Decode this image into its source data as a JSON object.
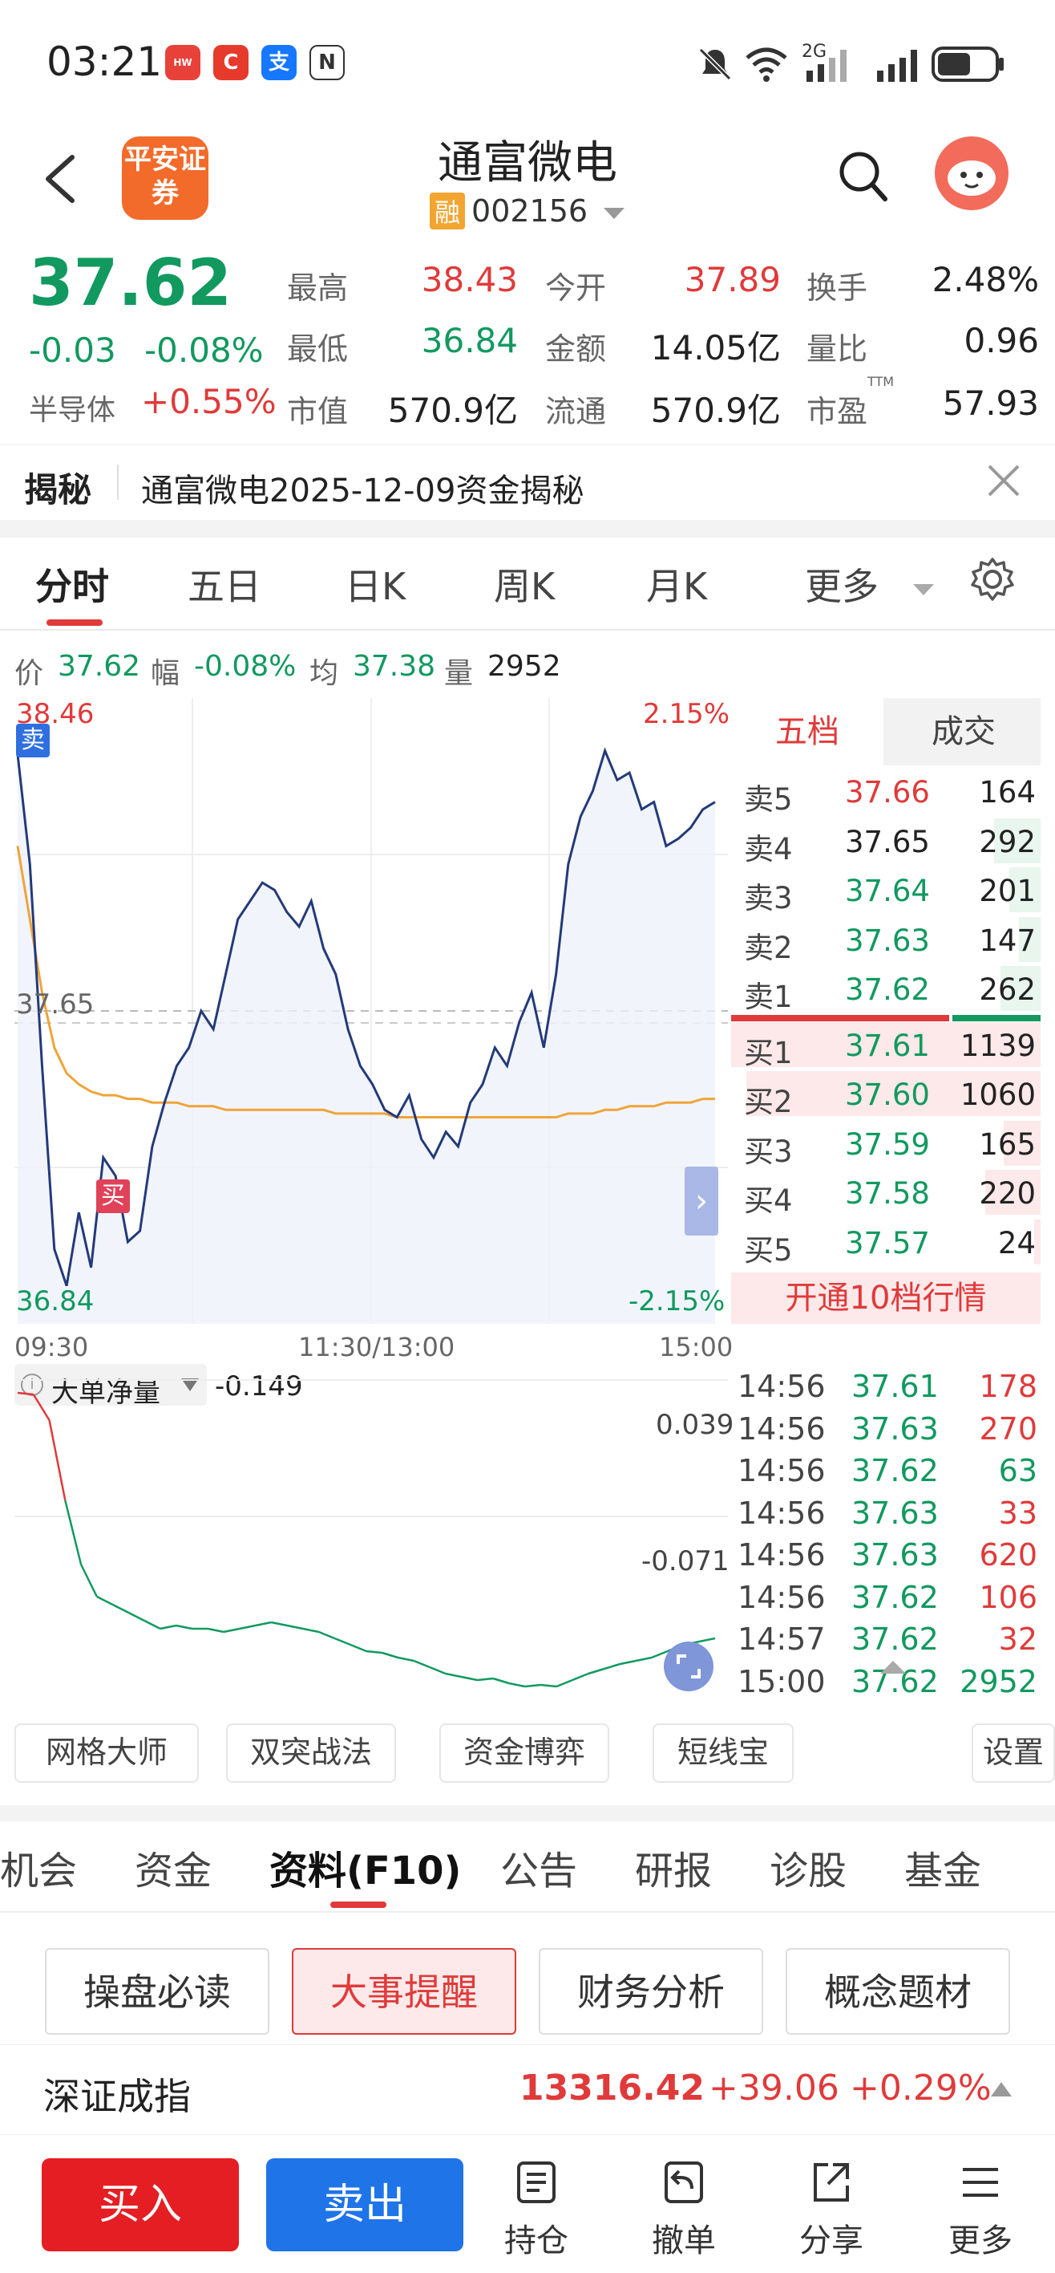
{
  "status_bar": {
    "time": "03:21",
    "network": "2G",
    "icons": [
      "huawei-app-icon",
      "c-app-icon",
      "alipay-icon",
      "nfc-icon",
      "mute-icon",
      "wifi-icon",
      "signal-icon",
      "battery-icon"
    ]
  },
  "header": {
    "logo_text": "平安证券",
    "title": "通富微电",
    "tag": "融",
    "code": "002156"
  },
  "quote": {
    "price": "37.62",
    "change": "-0.03",
    "change_pct": "-0.08%",
    "sector_name": "半导体",
    "sector_pct": "+0.55%",
    "rows": [
      [
        {
          "label": "最高",
          "value": "38.43",
          "color": "red"
        },
        {
          "label": "今开",
          "value": "37.89",
          "color": "red"
        },
        {
          "label": "换手",
          "value": "2.48%",
          "color": "black"
        }
      ],
      [
        {
          "label": "最低",
          "value": "36.84",
          "color": "green"
        },
        {
          "label": "金额",
          "value": "14.05亿",
          "color": "black"
        },
        {
          "label": "量比",
          "value": "0.96",
          "color": "black"
        }
      ],
      [
        {
          "label": "市值",
          "value": "570.9亿",
          "color": "black"
        },
        {
          "label": "流通",
          "value": "570.9亿",
          "color": "black"
        },
        {
          "label": "市盈",
          "value": "57.93",
          "color": "black",
          "sup": "TTM"
        }
      ]
    ]
  },
  "notice": {
    "tag": "揭秘",
    "text": "通富微电2025-12-09资金揭秘"
  },
  "chart_tabs": [
    "分时",
    "五日",
    "日K",
    "周K",
    "月K",
    "更多"
  ],
  "info_line": {
    "price_label": "价",
    "price": "37.62",
    "range_label": "幅",
    "range": "-0.08%",
    "avg_label": "均",
    "avg": "37.38",
    "vol_label": "量",
    "vol": "2952"
  },
  "chart_labels": {
    "max": "38.46",
    "min": "36.84",
    "max_pct": "2.15%",
    "min_pct": "-2.15%",
    "ref": "37.65",
    "sell_tag": "卖",
    "buy_tag": "买",
    "t_start": "09:30",
    "t_mid": "11:30/13:00",
    "t_end": "15:00"
  },
  "chart_data": {
    "type": "line",
    "x_range": [
      "09:30",
      "15:00"
    ],
    "ylim": [
      36.84,
      38.46
    ],
    "series": [
      {
        "name": "价",
        "values": [
          38.35,
          38.05,
          37.5,
          37.0,
          36.9,
          37.1,
          36.95,
          37.25,
          37.2,
          37.02,
          37.05,
          37.28,
          37.4,
          37.5,
          37.55,
          37.65,
          37.6,
          37.75,
          37.9,
          37.95,
          38.0,
          37.98,
          37.92,
          37.88,
          37.95,
          37.82,
          37.75,
          37.6,
          37.5,
          37.45,
          37.38,
          37.36,
          37.42,
          37.3,
          37.25,
          37.32,
          37.28,
          37.4,
          37.45,
          37.55,
          37.5,
          37.62,
          37.7,
          37.55,
          37.75,
          38.05,
          38.18,
          38.25,
          38.36,
          38.28,
          38.3,
          38.2,
          38.22,
          38.1,
          38.12,
          38.15,
          38.2,
          38.22
        ]
      },
      {
        "name": "均",
        "values": [
          38.1,
          37.9,
          37.7,
          37.55,
          37.48,
          37.45,
          37.43,
          37.42,
          37.42,
          37.41,
          37.41,
          37.4,
          37.4,
          37.4,
          37.39,
          37.39,
          37.39,
          37.38,
          37.38,
          37.38,
          37.38,
          37.38,
          37.38,
          37.38,
          37.38,
          37.38,
          37.37,
          37.37,
          37.37,
          37.37,
          37.37,
          37.36,
          37.36,
          37.36,
          37.36,
          37.36,
          37.36,
          37.36,
          37.36,
          37.36,
          37.36,
          37.36,
          37.36,
          37.36,
          37.36,
          37.37,
          37.37,
          37.37,
          37.38,
          37.38,
          37.39,
          37.39,
          37.39,
          37.4,
          37.4,
          37.4,
          37.41,
          37.41
        ]
      },
      {
        "name": "大单净量",
        "values": [
          0.037,
          0.036,
          0.02,
          -0.03,
          -0.07,
          -0.09,
          -0.095,
          -0.1,
          -0.105,
          -0.11,
          -0.108,
          -0.11,
          -0.11,
          -0.112,
          -0.11,
          -0.108,
          -0.106,
          -0.108,
          -0.11,
          -0.112,
          -0.116,
          -0.12,
          -0.124,
          -0.125,
          -0.128,
          -0.13,
          -0.134,
          -0.138,
          -0.14,
          -0.142,
          -0.141,
          -0.144,
          -0.146,
          -0.145,
          -0.146,
          -0.142,
          -0.138,
          -0.135,
          -0.132,
          -0.13,
          -0.128,
          -0.124,
          -0.12,
          -0.118,
          -0.116
        ]
      }
    ],
    "y_ticks": [
      "0.039",
      "-0.071"
    ]
  },
  "indicator": {
    "name": "大单净量",
    "value": "-0.149"
  },
  "order_book": {
    "tabs": [
      "五档",
      "成交"
    ],
    "asks": [
      {
        "label": "卖5",
        "price": "37.66",
        "vol": "164",
        "price_color": "red",
        "bar": 0.0
      },
      {
        "label": "卖4",
        "price": "37.65",
        "vol": "292",
        "price_color": "black",
        "bar": 0.15
      },
      {
        "label": "卖3",
        "price": "37.64",
        "vol": "201",
        "price_color": "green",
        "bar": 0.1
      },
      {
        "label": "卖2",
        "price": "37.63",
        "vol": "147",
        "price_color": "green",
        "bar": 0.07
      },
      {
        "label": "卖1",
        "price": "37.62",
        "vol": "262",
        "price_color": "green",
        "bar": 0.13
      }
    ],
    "bids": [
      {
        "label": "买1",
        "price": "37.61",
        "vol": "1139",
        "price_color": "green",
        "bar": 1.0
      },
      {
        "label": "买2",
        "price": "37.60",
        "vol": "1060",
        "price_color": "green",
        "bar": 0.95
      },
      {
        "label": "买3",
        "price": "37.59",
        "vol": "165",
        "price_color": "green",
        "bar": 0.12
      },
      {
        "label": "买4",
        "price": "37.58",
        "vol": "220",
        "price_color": "green",
        "bar": 0.18
      },
      {
        "label": "买5",
        "price": "37.57",
        "vol": "24",
        "price_color": "green",
        "bar": 0.02
      }
    ],
    "upgrade": "开通10档行情"
  },
  "trades": [
    {
      "time": "14:56",
      "price": "37.61",
      "vol": "178",
      "color": "red"
    },
    {
      "time": "14:56",
      "price": "37.63",
      "vol": "270",
      "color": "red"
    },
    {
      "time": "14:56",
      "price": "37.62",
      "vol": "63",
      "color": "green"
    },
    {
      "time": "14:56",
      "price": "37.63",
      "vol": "33",
      "color": "red"
    },
    {
      "time": "14:56",
      "price": "37.63",
      "vol": "620",
      "color": "red"
    },
    {
      "time": "14:56",
      "price": "37.62",
      "vol": "106",
      "color": "red"
    },
    {
      "time": "14:57",
      "price": "37.62",
      "vol": "32",
      "color": "red"
    },
    {
      "time": "15:00",
      "price": "37.62",
      "vol": "2952",
      "color": "green"
    }
  ],
  "tool_buttons": [
    "网格大师",
    "双突战法",
    "资金博弈",
    "短线宝"
  ],
  "settings_label": "设置",
  "lower_tabs": [
    "机会",
    "资金",
    "资料(F10)",
    "公告",
    "研报",
    "诊股",
    "基金"
  ],
  "sub_buttons": [
    "操盘必读",
    "大事提醒",
    "财务分析",
    "概念题材"
  ],
  "index_bar": {
    "name": "深证成指",
    "value": "13316.42",
    "change": "+39.06",
    "pct": "+0.29%"
  },
  "bottom_bar": {
    "buy": "买入",
    "sell": "卖出",
    "items": [
      "持仓",
      "撤单",
      "分享",
      "更多"
    ]
  },
  "colors": {
    "red": "#e03a3a",
    "green": "#11995f",
    "blue": "#2f6fe0",
    "orange": "#f0a43a",
    "line": "#233a7a"
  }
}
